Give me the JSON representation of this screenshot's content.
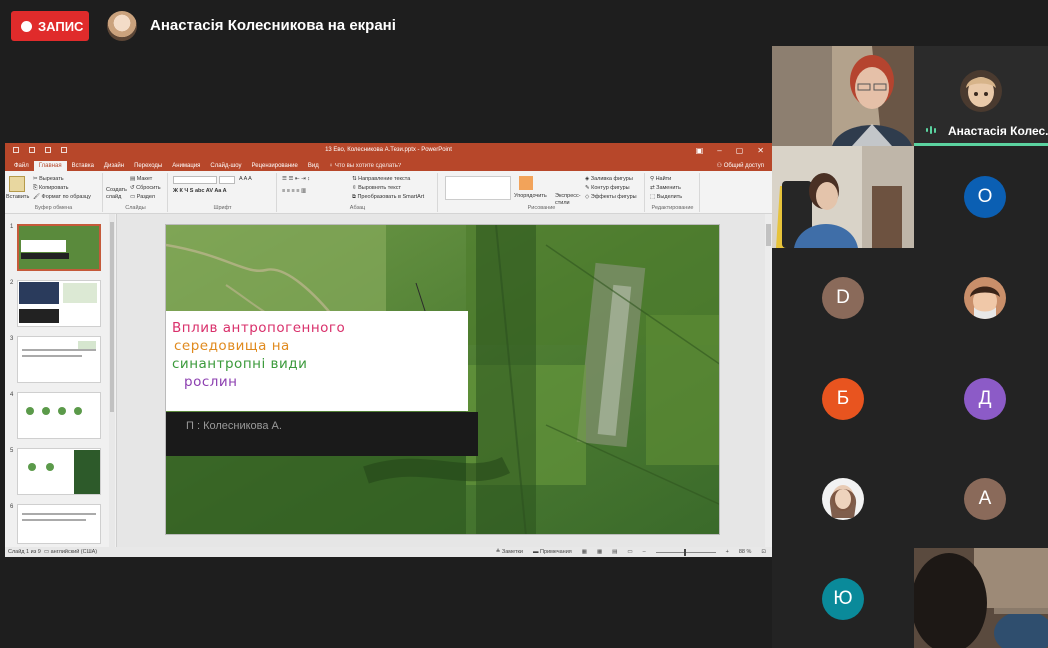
{
  "top_bar": {
    "record_label": "ЗАПИС",
    "presenter_title": "Анастасія Колесникова на екрані"
  },
  "powerpoint": {
    "file_title": "13 Ево, Колесникова А.Тези.pptx - PowerPoint",
    "tabs": [
      "Файл",
      "Главная",
      "Вставка",
      "Дизайн",
      "Переходы",
      "Анимация",
      "Слайд-шоу",
      "Рецензирование",
      "Вид"
    ],
    "active_tab": "Главная",
    "tell_me": "Что вы хотите сделать?",
    "share": "Общий доступ",
    "ribbon": {
      "clipboard": {
        "paste": "Вставить",
        "cut": "Вырезать",
        "copy": "Копировать",
        "format": "Формат по образцу",
        "name": "Буфер обмена"
      },
      "slides": {
        "new_slide": "Создать слайд",
        "layout": "Макет",
        "reset": "Сбросить",
        "section": "Раздел",
        "name": "Слайды"
      },
      "font": {
        "name": "Шрифт"
      },
      "paragraph": {
        "text_direction": "Направление текста",
        "align_text": "Выровнять текст",
        "smartart": "Преобразовать в SmartArt",
        "name": "Абзац"
      },
      "drawing": {
        "arrange": "Упорядочить",
        "quick_styles": "Экспресс-стили",
        "fill": "Заливка фигуры",
        "outline": "Контур фигуры",
        "effects": "Эффекты фигуры",
        "name": "Рисование"
      },
      "editing": {
        "find": "Найти",
        "replace": "Заменить",
        "select": "Выделить",
        "name": "Редактирование"
      }
    },
    "thumbnails": [
      "1",
      "2",
      "3",
      "4",
      "5",
      "6"
    ],
    "slide": {
      "title_line_1": "Вплив антропогенного",
      "title_line_2": "середовища на",
      "title_line_3": "синантропні види",
      "title_line_4": "рослин",
      "author": "П : Колесникова А."
    },
    "status": {
      "slide_info": "Слайд 1 из 9",
      "language": "английский (США)",
      "notes": "Заметки",
      "comments": "Примечания",
      "zoom": "88 %"
    }
  },
  "participants": [
    {
      "name": "Анастасія Колес...",
      "type": "photo",
      "speaking": true
    },
    {
      "initial": "О",
      "color": "#0b5fb3"
    },
    {
      "initial": "D",
      "color": "#8a6a5a"
    },
    {
      "initial": "Б",
      "color": "#e8541f"
    },
    {
      "initial": "Д",
      "color": "#8c5bc7"
    },
    {
      "initial": "A",
      "color": "#8a6a5a"
    },
    {
      "initial": "Ю",
      "color": "#0a8a9a"
    }
  ],
  "colors": {
    "record": "#e02b2b",
    "ppt_accent": "#b7472a",
    "speaking": "#5bd3a0"
  }
}
